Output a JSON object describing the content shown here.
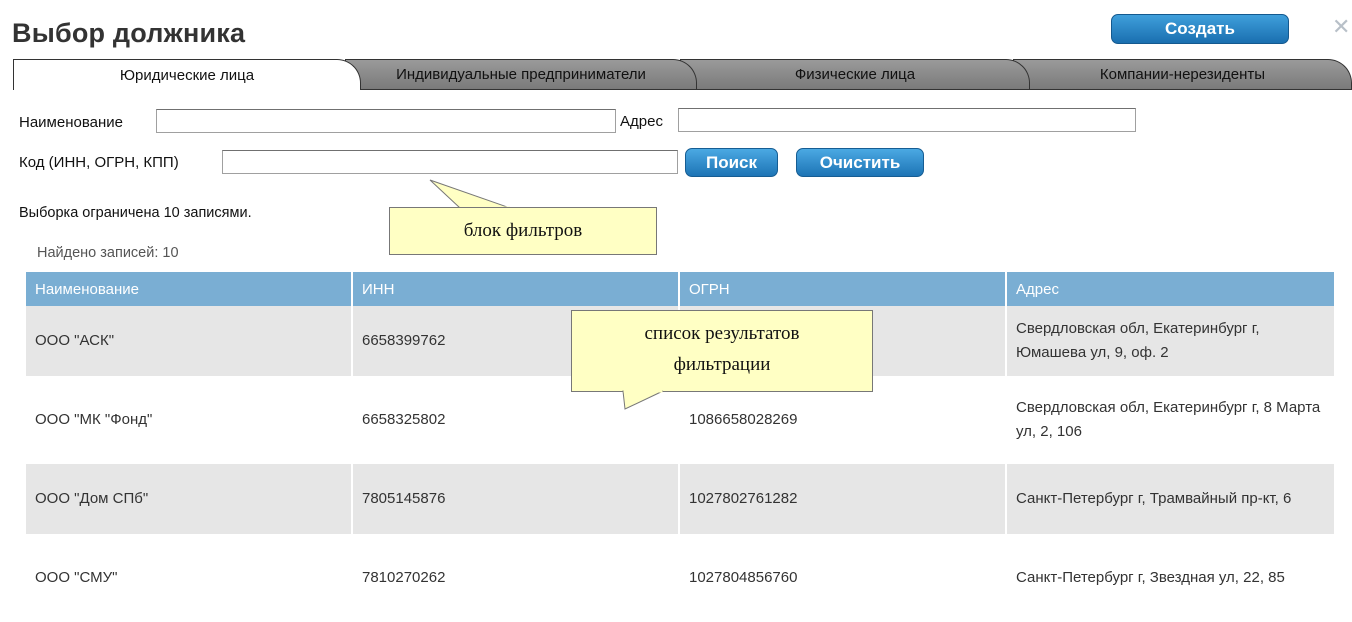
{
  "dialog": {
    "title": "Выбор должника",
    "create_label": "Создать",
    "close_symbol": "✕"
  },
  "tabs": [
    {
      "label": "Юридические лица",
      "active": true
    },
    {
      "label": "Индивидуальные предприниматели",
      "active": false
    },
    {
      "label": "Физические лица",
      "active": false
    },
    {
      "label": "Компании-нерезиденты",
      "active": false
    }
  ],
  "filters": {
    "name_label": "Наименование",
    "name_value": "",
    "address_label": "Адрес",
    "address_value": "",
    "code_label": "Код (ИНН, ОГРН, КПП)",
    "code_value": "",
    "search_label": "Поиск",
    "clear_label": "Очистить"
  },
  "limit_note": "Выборка ограничена 10 записями.",
  "found_text": "Найдено записей: 10",
  "table": {
    "headers": [
      "Наименование",
      "ИНН",
      "ОГРН",
      "Адрес"
    ],
    "rows": [
      {
        "name": "ООО \"АСК\"",
        "inn": "6658399762",
        "ogrn": "",
        "address": "Свердловская обл, Екатеринбург г, Юмашева ул, 9, оф. 2"
      },
      {
        "name": "ООО \"МК \"Фонд\"",
        "inn": "6658325802",
        "ogrn": "1086658028269",
        "address": "Свердловская обл, Екатеринбург г, 8 Марта ул, 2, 106"
      },
      {
        "name": "ООО \"Дом СПб\"",
        "inn": "7805145876",
        "ogrn": "1027802761282",
        "address": "Санкт-Петербург г, Трамвайный пр-кт, 6"
      },
      {
        "name": "ООО \"СМУ\"",
        "inn": "7810270262",
        "ogrn": "1027804856760",
        "address": "Санкт-Петербург г, Звездная ул, 22, 85"
      }
    ]
  },
  "callouts": {
    "filters": "блок фильтров",
    "results_line1": "список результатов",
    "results_line2": "фильтрации"
  },
  "colors": {
    "header_bg": "#7aaed3",
    "button_blue": "#1d74b5",
    "callout_bg": "#ffffc4"
  }
}
